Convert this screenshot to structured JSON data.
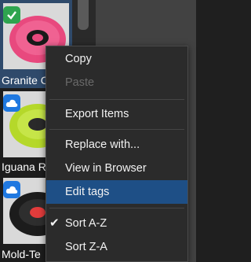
{
  "tiles": [
    {
      "name": "Granite C",
      "badge": "check",
      "selected": true,
      "thumb": "pink-disc-thumbnail"
    },
    {
      "name": "Iguana R",
      "badge": "cloud",
      "selected": false,
      "thumb": "green-disc-thumbnail"
    },
    {
      "name": "Mold-Te",
      "badge": "cloud",
      "selected": false,
      "thumb": "black-disc-thumbnail"
    }
  ],
  "context_menu": {
    "items": [
      {
        "id": "copy",
        "label": "Copy",
        "enabled": true
      },
      {
        "id": "paste",
        "label": "Paste",
        "enabled": false
      },
      {
        "id": "export",
        "label": "Export Items",
        "enabled": true
      },
      {
        "id": "replace",
        "label": "Replace with...",
        "enabled": true
      },
      {
        "id": "view-browser",
        "label": "View in Browser",
        "enabled": true
      },
      {
        "id": "edit-tags",
        "label": "Edit tags",
        "enabled": true,
        "highlighted": true
      },
      {
        "id": "sort-az",
        "label": "Sort A-Z",
        "enabled": true,
        "checked": true
      },
      {
        "id": "sort-za",
        "label": "Sort Z-A",
        "enabled": true
      }
    ]
  },
  "colors": {
    "menu_bg": "#2b2b2b",
    "highlight": "#1e4f86",
    "check_badge": "#2ea44f",
    "cloud_badge": "#1f78e0",
    "selected_tile": "#2f4a6b"
  }
}
